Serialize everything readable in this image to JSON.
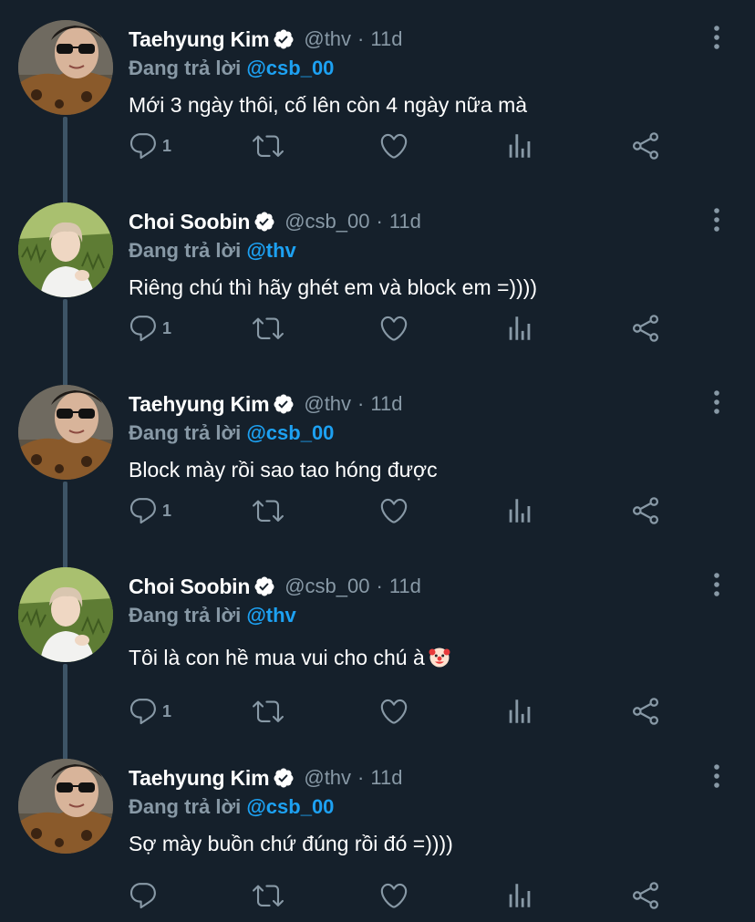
{
  "labels": {
    "replying_prefix": "Đang trả lời"
  },
  "tweets": [
    {
      "author": "Taehyung Kim",
      "handle": "@thv",
      "separator": "·",
      "time": "11d",
      "replying_to": "@csb_00",
      "text": "Mới 3 ngày thôi, cố lên còn 4 ngày nữa mà",
      "reply_count": "1"
    },
    {
      "author": "Choi Soobin",
      "handle": "@csb_00",
      "separator": "·",
      "time": "11d",
      "replying_to": "@thv",
      "text": "Riêng chú thì hãy ghét em và block em =))))",
      "reply_count": "1"
    },
    {
      "author": "Taehyung Kim",
      "handle": "@thv",
      "separator": "·",
      "time": "11d",
      "replying_to": "@csb_00",
      "text": "Block mày rồi sao tao hóng được",
      "reply_count": "1"
    },
    {
      "author": "Choi Soobin",
      "handle": "@csb_00",
      "separator": "·",
      "time": "11d",
      "replying_to": "@thv",
      "text": "Tôi là con hề mua vui cho chú à",
      "emoji": "clown-face-emoji",
      "reply_count": "1"
    },
    {
      "author": "Taehyung Kim",
      "handle": "@thv",
      "separator": "·",
      "time": "11d",
      "replying_to": "@csb_00",
      "text": "Sợ mày buồn chứ đúng rồi đó =))))",
      "reply_count": ""
    }
  ],
  "icons": {
    "reply": "reply-icon",
    "retweet": "retweet-icon",
    "like": "heart-icon",
    "analytics": "analytics-icon",
    "share": "share-icon",
    "more": "more-vertical-icon",
    "verified": "verified-badge-icon"
  },
  "colors": {
    "background": "#15202b",
    "secondary_text": "#8899a6",
    "mention": "#1da1f2",
    "thread_line": "#3d5466"
  }
}
